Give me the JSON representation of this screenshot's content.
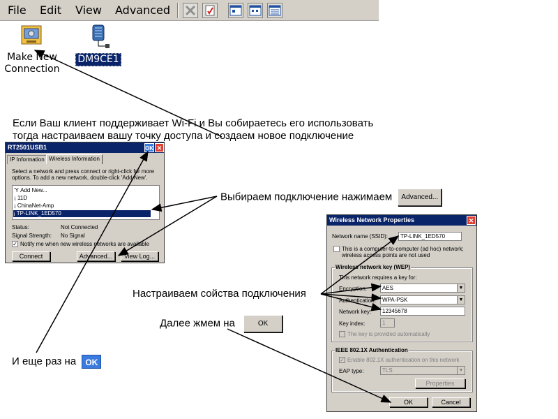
{
  "menubar": {
    "items": [
      {
        "label": "File"
      },
      {
        "label": "Edit"
      },
      {
        "label": "View"
      },
      {
        "label": "Advanced"
      }
    ],
    "tool_icons": [
      "delete-icon",
      "properties-icon",
      "large-icons-view-icon",
      "small-icons-view-icon",
      "details-view-icon"
    ]
  },
  "desktop": {
    "icons": [
      {
        "label_line1": "Make New",
        "label_line2": "Connection",
        "icon": "make-connection-icon"
      },
      {
        "label": "DM9CE1",
        "icon": "network-adapter-icon"
      }
    ]
  },
  "instructions": {
    "line1": "Если Ваш клиент поддерживает Wi-Fi и Вы собираетесь его использовать",
    "line2": "тогда настраиваем вашу точку доступа и создаем новое подключение",
    "choose_connection": "Выбираем подключение нажимаем",
    "choose_button": "Advanced...",
    "configure": "Настраиваем сойства подключения",
    "then_press": "Далее жмем на",
    "then_button": "OK",
    "again": "И еще раз на",
    "again_button": "OK"
  },
  "dialog1": {
    "title": "RT2501USB1",
    "ok": "OK",
    "close": "✕",
    "tabs": [
      "IP Information",
      "Wireless Information"
    ],
    "help_line1": "Select a network and press connect or right-click for more",
    "help_line2": "options.  To add a new network, double-click 'Add New'.",
    "networks": [
      {
        "label": "Add New...",
        "selected": false
      },
      {
        "label": "11D",
        "selected": false
      },
      {
        "label": "ChinaNet-Amp",
        "selected": false
      },
      {
        "label": "TP-LINK_1ED570",
        "selected": true
      }
    ],
    "status_label": "Status:",
    "status_value": "Not Connected",
    "signal_label": "Signal Strength:",
    "signal_value": "No Signal",
    "notify_label": "Notify me when new wireless networks are available",
    "notify_checked": true,
    "buttons": {
      "connect": "Connect",
      "advanced": "Advanced...",
      "view_log": "View Log..."
    }
  },
  "dialog2": {
    "title": "Wireless Network Properties",
    "close": "✕",
    "ssid_label": "Network name (SSID):",
    "ssid_value": "TP-LINK_1ED570",
    "adhoc_label_line1": "This is a computer-to-computer (ad hoc) network;",
    "adhoc_label_line2": "wireless access points are not used",
    "wep_group": "Wireless network key (WEP)",
    "requires_key": "This network requires a key for:",
    "encryption_label": "Encryption:",
    "encryption_value": "AES",
    "authentication_label": "Authentication:",
    "authentication_value": "WPA-PSK",
    "network_key_label": "Network key:",
    "network_key_value": "12345678",
    "key_index_label": "Key index:",
    "key_index_value": "1",
    "auto_key_label": "The key is provided automatically",
    "ieee_group": "IEEE 802.1X Authentication",
    "enable_8021x_label": "Enable 802.1X authentication on this network",
    "eap_label": "EAP type:",
    "eap_value": "TLS",
    "properties_button": "Properties",
    "ok_button": "OK",
    "cancel_button": "Cancel"
  }
}
